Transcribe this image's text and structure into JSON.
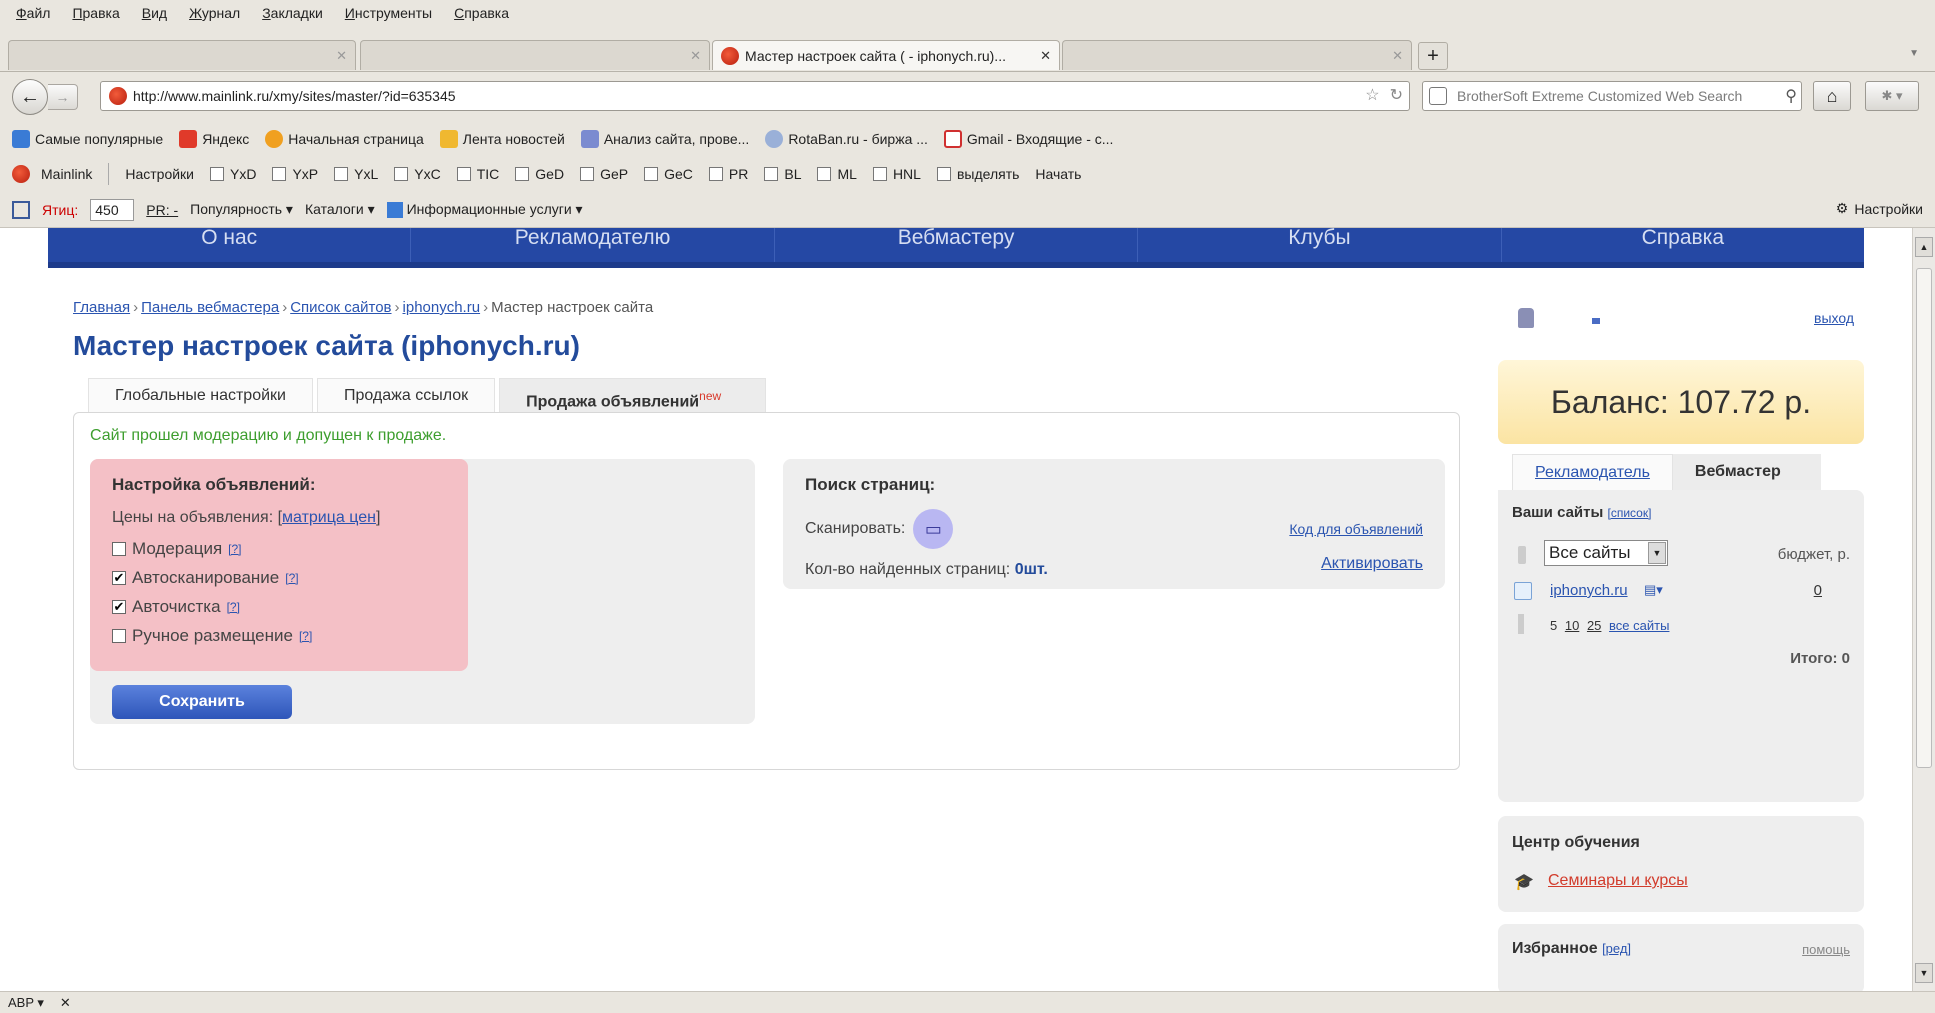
{
  "browser": {
    "menu": [
      "Файл",
      "Правка",
      "Вид",
      "Журнал",
      "Закладки",
      "Инструменты",
      "Справка"
    ],
    "tabs": [
      {
        "label": "",
        "active": false
      },
      {
        "label": "",
        "active": false
      },
      {
        "label": "Мастер настроек сайта ( - iphonych.ru)...",
        "active": true
      },
      {
        "label": "",
        "active": false
      }
    ],
    "url": "http://www.mainlink.ru/xmy/sites/master/?id=635345",
    "search_placeholder": "BrotherSoft Extreme Customized Web Search"
  },
  "bookmarks": [
    {
      "label": "Самые популярные",
      "color": "#3a7bd5"
    },
    {
      "label": "Яндекс",
      "color": "#e03a2a"
    },
    {
      "label": "Начальная страница",
      "color": "#f0a020"
    },
    {
      "label": "Лента новостей",
      "color": "#f0b830"
    },
    {
      "label": "Анализ сайта, прове...",
      "color": "#7b8bd0"
    },
    {
      "label": "RotaBan.ru - биржа ...",
      "color": "#9ab0d8"
    },
    {
      "label": "Gmail - Входящие - с...",
      "color": "#d03030"
    }
  ],
  "mainlink_bar": {
    "brand": "Mainlink",
    "settings": "Настройки",
    "checks": [
      "YxD",
      "YxP",
      "YxL",
      "YxC",
      "TIC",
      "GeD",
      "GeP",
      "GeC",
      "PR",
      "BL",
      "ML",
      "HNL",
      "выделять"
    ],
    "start": "Начать"
  },
  "yandex_bar": {
    "tic_label": "Ятиц:",
    "tic_value": "450",
    "pr_label": "PR: -",
    "popularity": "Популярность",
    "catalogs": "Каталоги",
    "info": "Информационные услуги",
    "settings": "Настройки"
  },
  "site_nav": [
    "О нас",
    "Рекламодателю",
    "Вебмастеру",
    "Клубы",
    "Справка"
  ],
  "breadcrumb": {
    "items": [
      "Главная",
      "Панель вебмастера",
      "Список сайтов",
      "iphonych.ru"
    ],
    "current": "Мастер настроек сайта",
    "sep": "›"
  },
  "page": {
    "title": "Мастер настроек сайта (iphonych.ru)",
    "tabs": [
      "Глобальные настройки",
      "Продажа ссылок",
      "Продажа объявлений"
    ],
    "new_badge": "new",
    "status": "Сайт прошел модерацию и допущен к продаже."
  },
  "ad_settings": {
    "heading": "Настройка объявлений:",
    "prices_label": "Цены на объявления:",
    "prices_link": "матрица цен",
    "options": [
      {
        "label": "Модерация",
        "checked": false
      },
      {
        "label": "Автосканирование",
        "checked": true
      },
      {
        "label": "Авточистка",
        "checked": true
      },
      {
        "label": "Ручное размещение",
        "checked": false
      }
    ],
    "help": "[?]",
    "save": "Сохранить"
  },
  "page_search": {
    "heading": "Поиск страниц:",
    "scan_label": "Сканировать:",
    "found_label": "Кол-во найденных страниц:",
    "found_value": "0шт.",
    "code_link": "Код для объявлений",
    "activate": "Активировать"
  },
  "sidebar": {
    "logout": "выход",
    "balance": "Баланс: 107.72 р.",
    "tabs": [
      "Рекламодатель",
      "Вебмастер"
    ],
    "sites_heading": "Ваши сайты",
    "sites_list_link": "[список]",
    "select_value": "Все сайты",
    "budget_label": "бюджет, р.",
    "site_name": "iphonych.ru",
    "site_budget": "0",
    "pager": [
      "5",
      "10",
      "25",
      "все сайты"
    ],
    "total": "Итого: 0",
    "education_heading": "Центр обучения",
    "education_link": "Семинары и курсы",
    "favorites_heading": "Избранное",
    "favorites_edit": "[ред]",
    "help": "помощь"
  }
}
